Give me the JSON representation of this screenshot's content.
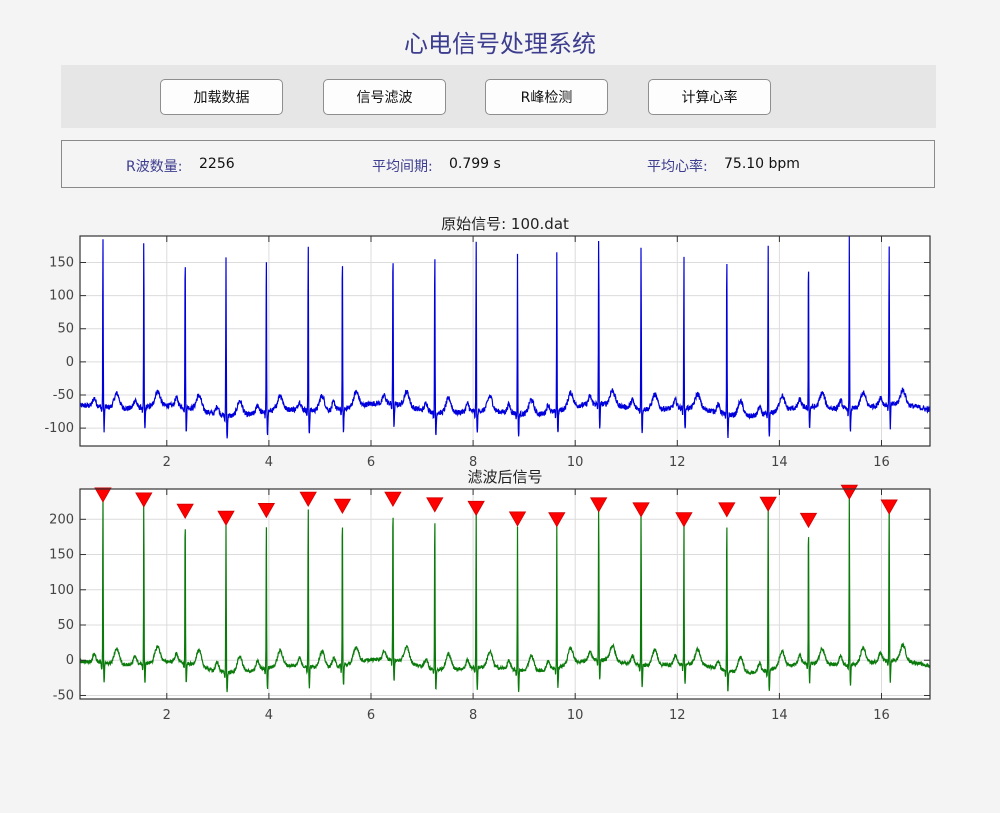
{
  "app": {
    "title": "心电信号处理系统"
  },
  "toolbar": {
    "buttons": [
      {
        "label": "加载数据"
      },
      {
        "label": "信号滤波"
      },
      {
        "label": "R峰检测"
      },
      {
        "label": "计算心率"
      }
    ]
  },
  "stats": {
    "r_count_label": "R波数量:",
    "r_count_value": "2256",
    "avg_interval_label": "平均间期:",
    "avg_interval_value": "0.799 s",
    "avg_hr_label": "平均心率:",
    "avg_hr_value": "75.10 bpm"
  },
  "colors": {
    "title": "#3d3d8f",
    "raw_signal": "#0000dd",
    "filtered_signal": "#0a7a0a",
    "r_peak_marker": "#ff0000"
  },
  "chart_data": [
    {
      "type": "line",
      "title": "原始信号: 100.dat",
      "xlim": [
        0.3,
        16.95
      ],
      "ylim": [
        -127,
        190
      ],
      "xticks": [
        2,
        4,
        6,
        8,
        10,
        12,
        14,
        16
      ],
      "yticks": [
        150,
        100,
        50,
        0,
        -50,
        -100
      ],
      "grid": true,
      "baseline": -72,
      "beats": [
        {
          "t": 0.75,
          "amp": 190
        },
        {
          "t": 1.55,
          "amp": 190
        },
        {
          "t": 2.36,
          "amp": 173
        },
        {
          "t": 3.16,
          "amp": 166
        },
        {
          "t": 3.95,
          "amp": 177
        },
        {
          "t": 4.77,
          "amp": 190
        },
        {
          "t": 5.44,
          "amp": 176
        },
        {
          "t": 6.43,
          "amp": 177
        },
        {
          "t": 7.25,
          "amp": 182
        },
        {
          "t": 8.06,
          "amp": 185
        },
        {
          "t": 8.87,
          "amp": 172
        },
        {
          "t": 9.64,
          "amp": 174
        },
        {
          "t": 10.46,
          "amp": 188
        },
        {
          "t": 11.29,
          "amp": 177
        },
        {
          "t": 12.13,
          "amp": 160
        },
        {
          "t": 12.97,
          "amp": 177
        },
        {
          "t": 13.78,
          "amp": 180
        },
        {
          "t": 14.57,
          "amp": 167
        },
        {
          "t": 15.37,
          "amp": 190
        },
        {
          "t": 16.15,
          "amp": 176
        }
      ]
    },
    {
      "type": "line",
      "title": "滤波后信号",
      "xlim": [
        0.3,
        16.95
      ],
      "ylim": [
        -55,
        243
      ],
      "xticks": [
        2,
        4,
        6,
        8,
        10,
        12,
        14,
        16
      ],
      "yticks": [
        200,
        150,
        100,
        50,
        0,
        -50
      ],
      "grid": true,
      "baseline": -8,
      "beats": [
        {
          "t": 0.75,
          "amp": 236
        },
        {
          "t": 1.55,
          "amp": 229
        },
        {
          "t": 2.36,
          "amp": 213
        },
        {
          "t": 3.16,
          "amp": 203
        },
        {
          "t": 3.95,
          "amp": 214
        },
        {
          "t": 4.77,
          "amp": 230
        },
        {
          "t": 5.44,
          "amp": 220
        },
        {
          "t": 6.43,
          "amp": 230
        },
        {
          "t": 7.25,
          "amp": 222
        },
        {
          "t": 8.06,
          "amp": 217
        },
        {
          "t": 8.87,
          "amp": 202
        },
        {
          "t": 9.64,
          "amp": 201
        },
        {
          "t": 10.46,
          "amp": 222
        },
        {
          "t": 11.29,
          "amp": 215
        },
        {
          "t": 12.13,
          "amp": 201
        },
        {
          "t": 12.97,
          "amp": 215
        },
        {
          "t": 13.78,
          "amp": 223
        },
        {
          "t": 14.57,
          "amp": 200
        },
        {
          "t": 15.37,
          "amp": 240
        },
        {
          "t": 16.15,
          "amp": 219
        }
      ],
      "r_peak_markers": true
    }
  ]
}
